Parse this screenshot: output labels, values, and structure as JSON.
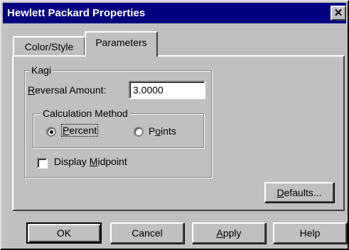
{
  "window": {
    "title": "Hewlett Packard Properties",
    "close_glyph": "✕"
  },
  "tabs": [
    {
      "label": "Color/Style",
      "active": false
    },
    {
      "label": "Parameters",
      "active": true
    }
  ],
  "kagi": {
    "group_label": "Kagi",
    "reversal_label_prefix": "",
    "reversal_label_mnemonic": "R",
    "reversal_label_rest": "eversal Amount:",
    "reversal_value": "3.0000",
    "calc_group_label": "Calculation Method",
    "options": [
      {
        "mnemonic": "P",
        "rest": "ercent",
        "selected": true
      },
      {
        "prefix": "P",
        "mnemonic": "o",
        "rest": "ints",
        "selected": false
      }
    ],
    "midpoint_prefix": "Display ",
    "midpoint_mnemonic": "M",
    "midpoint_rest": "idpoint",
    "midpoint_checked": false
  },
  "buttons": {
    "defaults_mnemonic": "D",
    "defaults_rest": "efaults...",
    "ok": "OK",
    "cancel": "Cancel",
    "apply_mnemonic": "A",
    "apply_rest": "pply",
    "help": "Help"
  },
  "colors": {
    "titlebar": "#000080",
    "face": "#c0c0c0"
  }
}
